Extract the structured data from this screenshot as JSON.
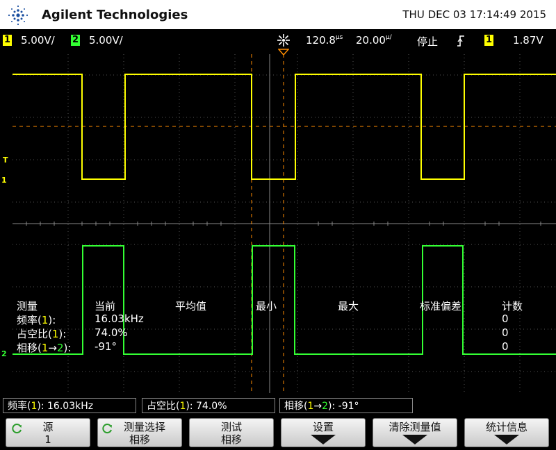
{
  "header": {
    "brand": "Agilent Technologies",
    "datetime": "THU DEC 03 17:14:49 2015"
  },
  "status": {
    "ch1_num": "1",
    "ch1_scale": "5.00V/",
    "ch2_num": "2",
    "ch2_scale": "5.00V/",
    "time_pos": "120.8",
    "time_pos_unit": "μs",
    "time_scale": "20.00",
    "time_scale_unit": "μ/",
    "run_state": "停止",
    "trigger_ch": "1",
    "trigger_level": "1.87V",
    "colors": {
      "ch1": "#ffff00",
      "ch2": "#33ff33"
    }
  },
  "markers": {
    "trigger": "T",
    "ch1": "1",
    "ch2": "2"
  },
  "measurements": {
    "headers": [
      "测量",
      "当前",
      "平均值",
      "最小",
      "最大",
      "标准偏差",
      "计数"
    ],
    "rows": [
      {
        "name": "频率",
        "ch": "1",
        "suffix": "):",
        "current": "16.03kHz",
        "count": "0"
      },
      {
        "name": "占空比",
        "ch": "1",
        "suffix": "):",
        "current": "74.0%",
        "count": "0"
      },
      {
        "name": "相移",
        "ch": "1",
        "arrow": "→",
        "ch2": "2",
        "suffix": "):",
        "current": "-91°",
        "count": "0"
      }
    ]
  },
  "readouts": [
    {
      "label": "频率",
      "ch": "1",
      "value": "): 16.03kHz"
    },
    {
      "label": "占空比",
      "ch": "1",
      "value": "): 74.0%"
    },
    {
      "label": "相移",
      "ch": "1",
      "arrow": "→",
      "ch2": "2",
      "value": "): -91°"
    }
  ],
  "softkeys": [
    {
      "line1": "源",
      "line2": "1",
      "icon": "rotate-knob-icon"
    },
    {
      "line1": "测量选择",
      "line2": "相移",
      "icon": "rotate-knob-icon"
    },
    {
      "line1": "测试",
      "line2": "相移"
    },
    {
      "line1": "设置",
      "icon": "down-arrow-icon"
    },
    {
      "line1": "清除测量值",
      "icon": "down-arrow-icon"
    },
    {
      "line1": "统计信息",
      "icon": "down-arrow-icon"
    }
  ]
}
